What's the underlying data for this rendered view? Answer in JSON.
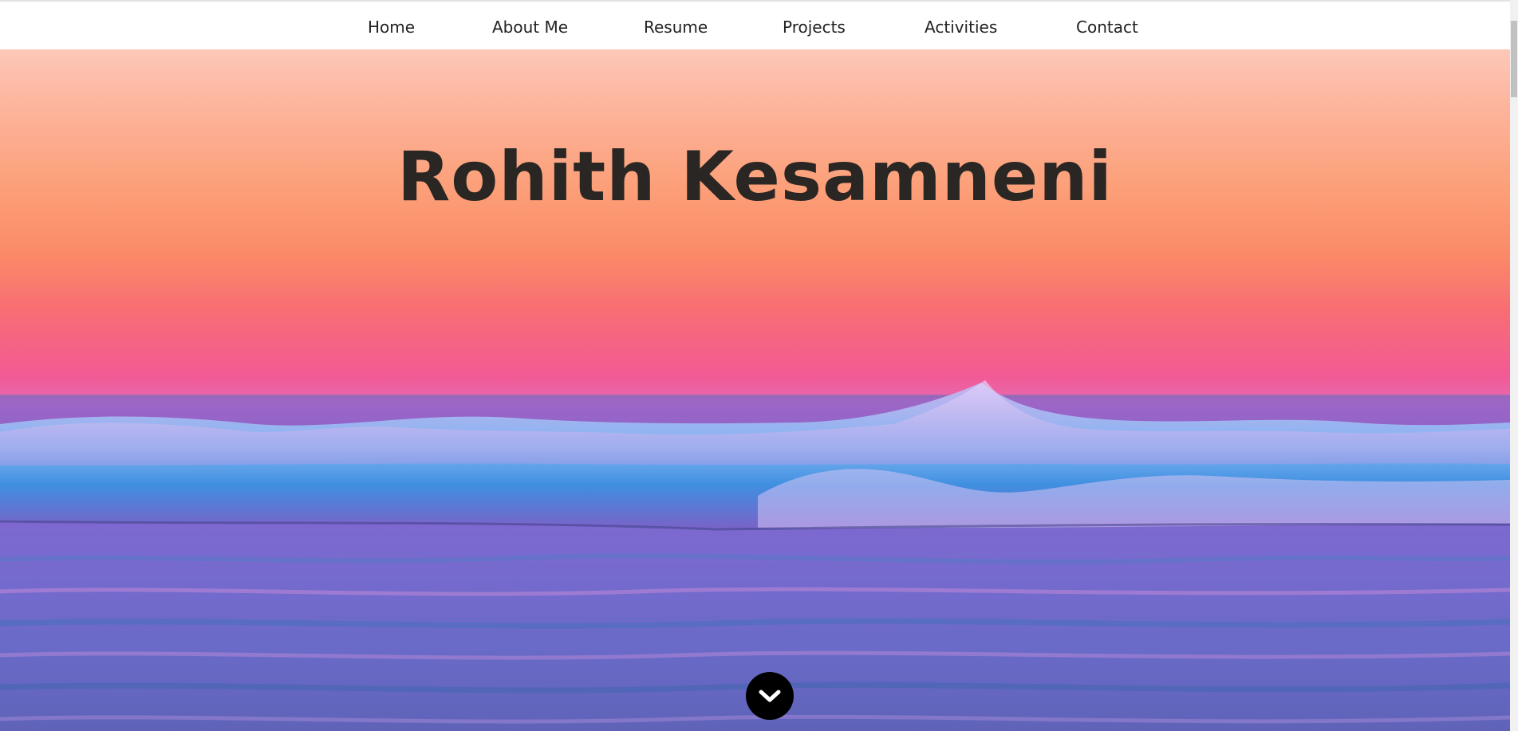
{
  "nav": {
    "items": [
      {
        "label": "Home"
      },
      {
        "label": "About Me"
      },
      {
        "label": "Resume"
      },
      {
        "label": "Projects"
      },
      {
        "label": "Activities"
      },
      {
        "label": "Contact"
      }
    ]
  },
  "hero": {
    "title": "Rohith Kesamneni",
    "background": "sunset-ocean-waves",
    "scroll_icon": "chevron-down-icon"
  },
  "colors": {
    "sky_top": "#fdc8b8",
    "sky_mid": "#fb8a68",
    "sky_horizon": "#f25a94",
    "sea": "#7f5fd0",
    "title": "#2a2623",
    "scroll_button": "#000000"
  }
}
